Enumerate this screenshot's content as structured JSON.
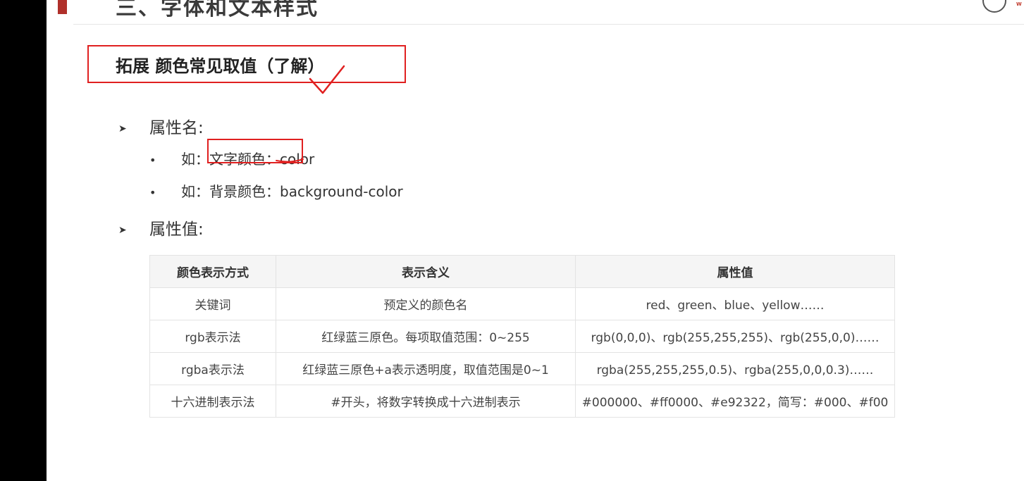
{
  "header": {
    "title": "三、字体和文本样式"
  },
  "section": {
    "heading": "拓展 颜色常见取值（了解）"
  },
  "bullets": {
    "attr_name": "属性名:",
    "examples": [
      "如：文字颜色：color",
      "如：背景颜色：background-color"
    ],
    "attr_value": "属性值:"
  },
  "table": {
    "headers": [
      "颜色表示方式",
      "表示含义",
      "属性值"
    ],
    "rows": [
      [
        "关键词",
        "预定义的颜色名",
        "red、green、blue、yellow……"
      ],
      [
        "rgb表示法",
        "红绿蓝三原色。每项取值范围：0~255",
        "rgb(0,0,0)、rgb(255,255,255)、rgb(255,0,0)……"
      ],
      [
        "rgba表示法",
        "红绿蓝三原色+a表示透明度，取值范围是0~1",
        "rgba(255,255,255,0.5)、rgba(255,0,0,0.3)……"
      ],
      [
        "十六进制表示法",
        "#开头，将数字转换成十六进制表示",
        "#000000、#ff0000、#e92322，简写：#000、#f00"
      ]
    ]
  },
  "colors": {
    "accent": "#b0302a",
    "annotation": "#e02020"
  }
}
